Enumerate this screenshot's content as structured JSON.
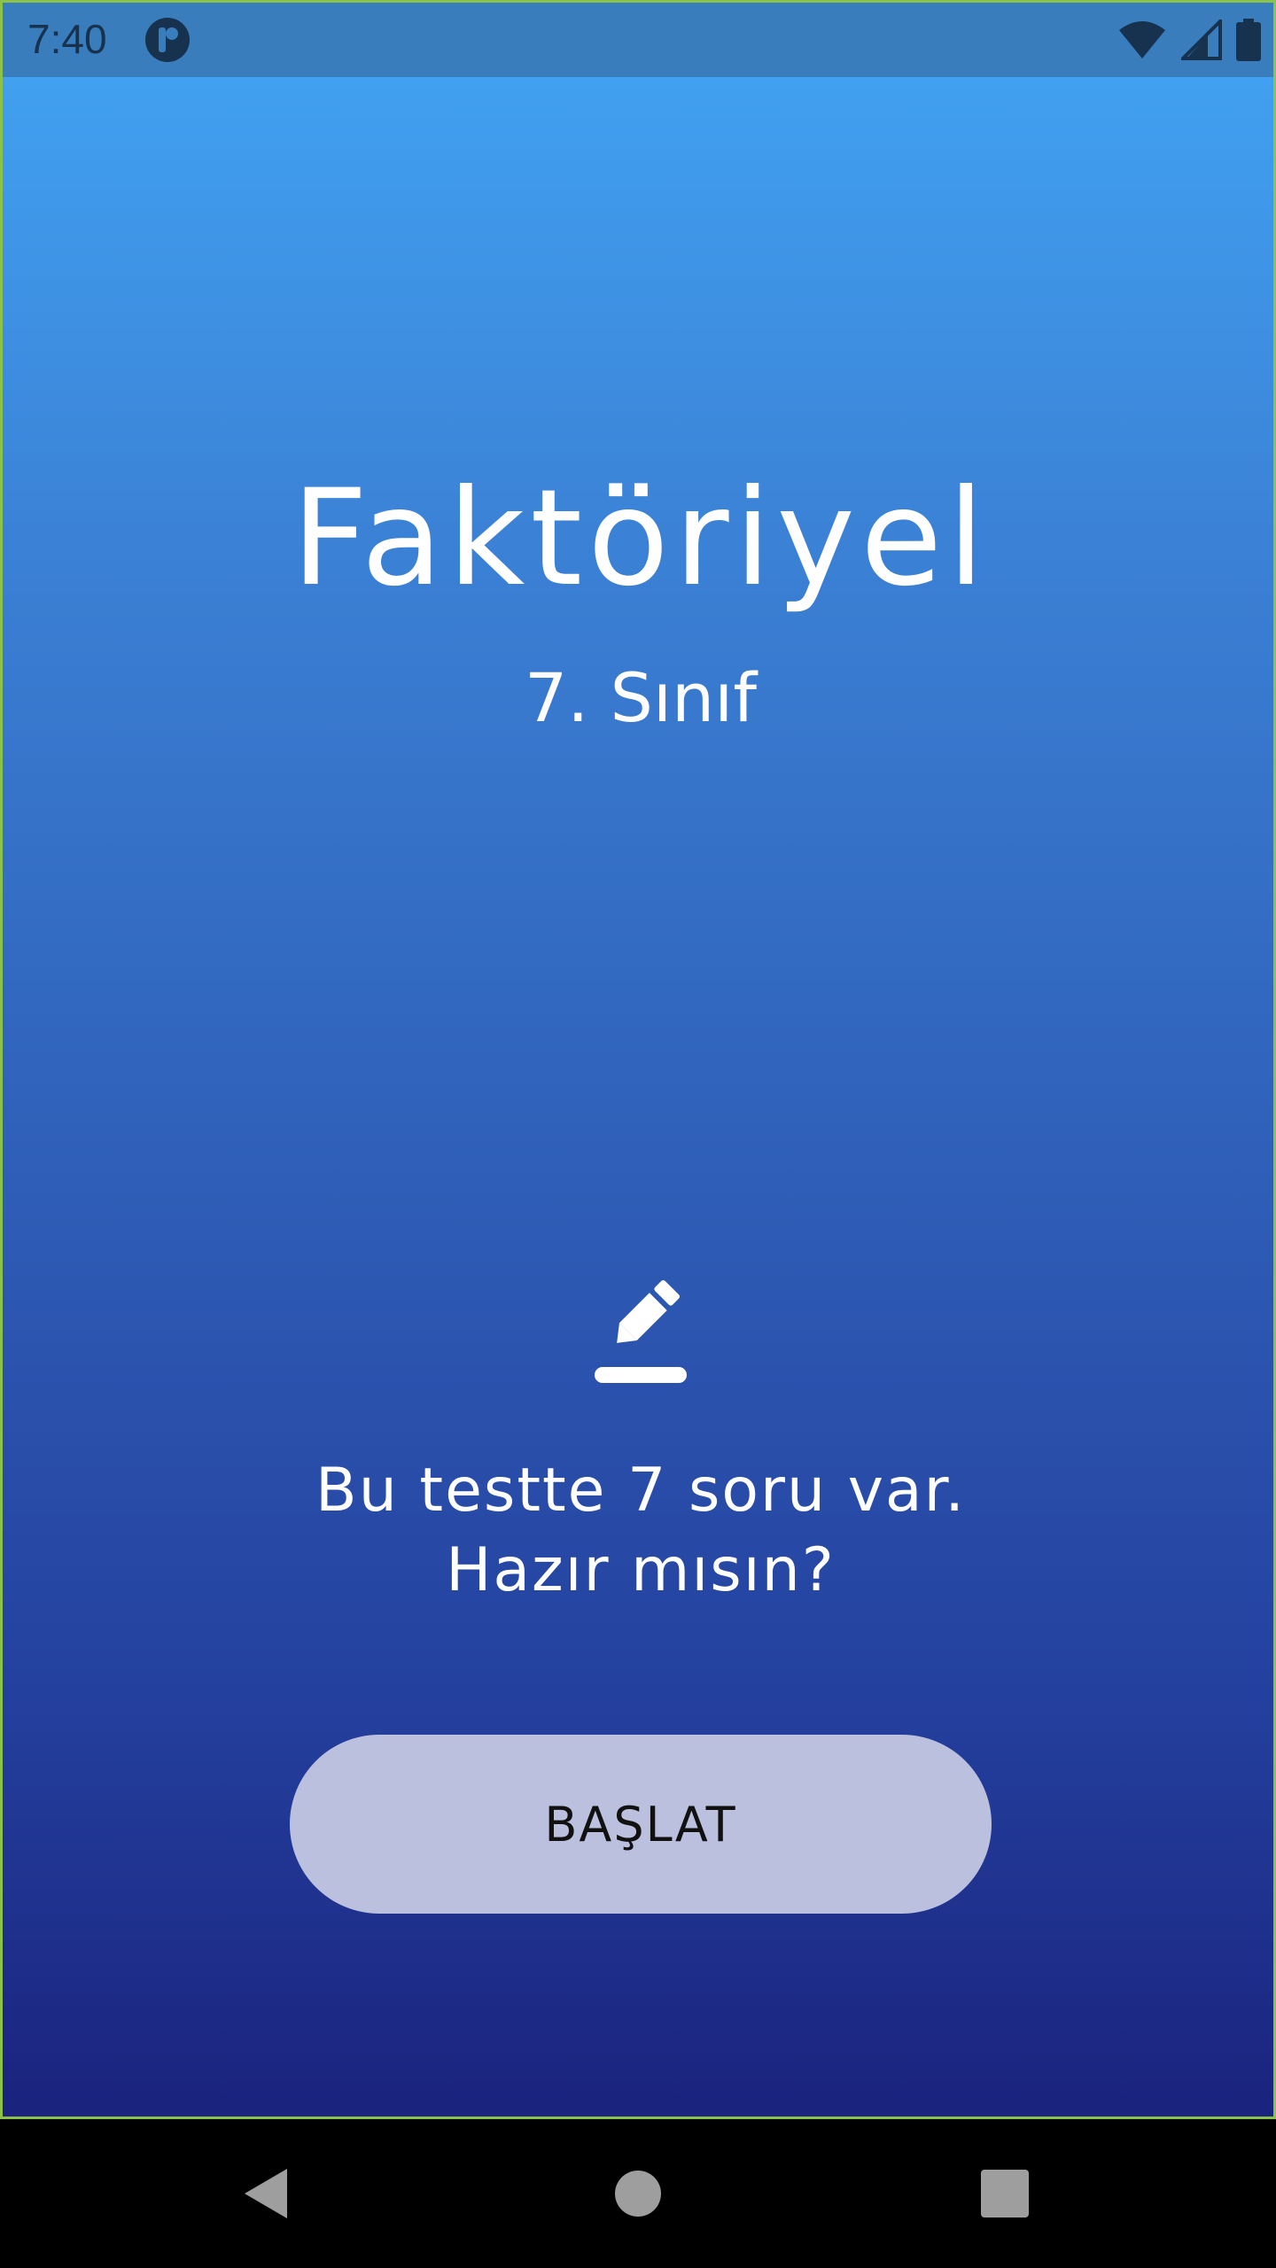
{
  "status_bar": {
    "time": "7:40",
    "app_icon": "app-notification-icon",
    "icons": [
      "wifi-icon",
      "cell-signal-icon",
      "battery-icon"
    ]
  },
  "main": {
    "title": "Faktöriyel",
    "subtitle": "7. Sınıf",
    "icon": "edit-pencil-icon",
    "message_line1": "Bu testte 7 soru var.",
    "message_line2": "Hazır mısın?",
    "start_button_label": "BAŞLAT"
  },
  "nav_bar": {
    "buttons": [
      "back-icon",
      "home-icon",
      "recents-icon"
    ]
  },
  "colors": {
    "gradient_top": "#42a5f5",
    "gradient_bottom": "#1a237e",
    "button_bg": "#bbc0df",
    "status_bar_bg": "#3a7dbd",
    "frame_border": "#8bc34a"
  }
}
